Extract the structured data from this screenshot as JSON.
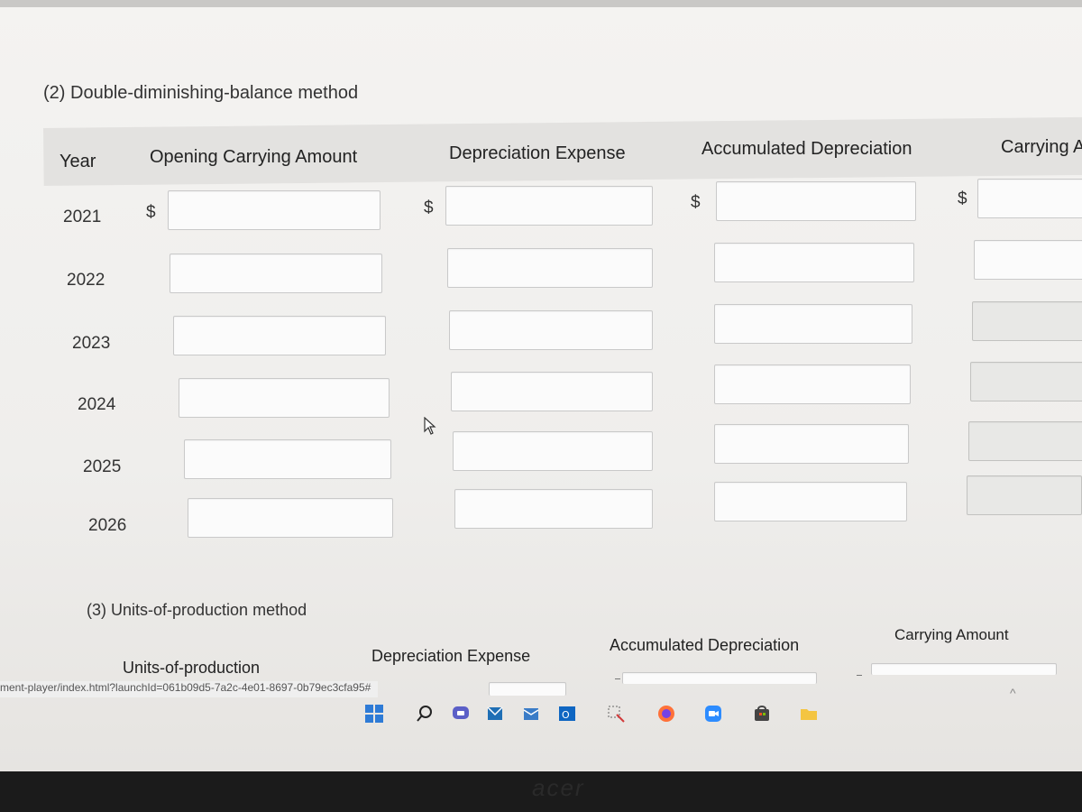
{
  "section2": {
    "title": "(2) Double-diminishing-balance method",
    "headers": {
      "year": "Year",
      "opening": "Opening Carrying Amount",
      "depreciation": "Depreciation Expense",
      "accumulated": "Accumulated Depreciation",
      "carrying": "Carrying A"
    },
    "currency_symbol": "$",
    "rows": [
      {
        "year": "2021"
      },
      {
        "year": "2022"
      },
      {
        "year": "2023"
      },
      {
        "year": "2024"
      },
      {
        "year": "2025"
      },
      {
        "year": "2026"
      }
    ]
  },
  "section3": {
    "title": "(3) Units-of-production method",
    "headers": {
      "units": "Units-of-production",
      "depreciation": "Depreciation Expense",
      "accumulated": "Accumulated Depreciation",
      "carrying": "Carrying Amount"
    }
  },
  "status_bar": {
    "url": "ment-player/index.html?launchId=061b09d5-7a2c-4e01-8697-0b79ec3cfa95#"
  },
  "taskbar": {
    "icons": [
      "windows-start-icon",
      "search-icon",
      "chat-icon",
      "mail-icon",
      "outlook-icon",
      "snipping-tool-icon",
      "firefox-icon",
      "zoom-icon",
      "store-icon",
      "file-explorer-icon"
    ]
  },
  "bezel": {
    "brand": "acer"
  }
}
